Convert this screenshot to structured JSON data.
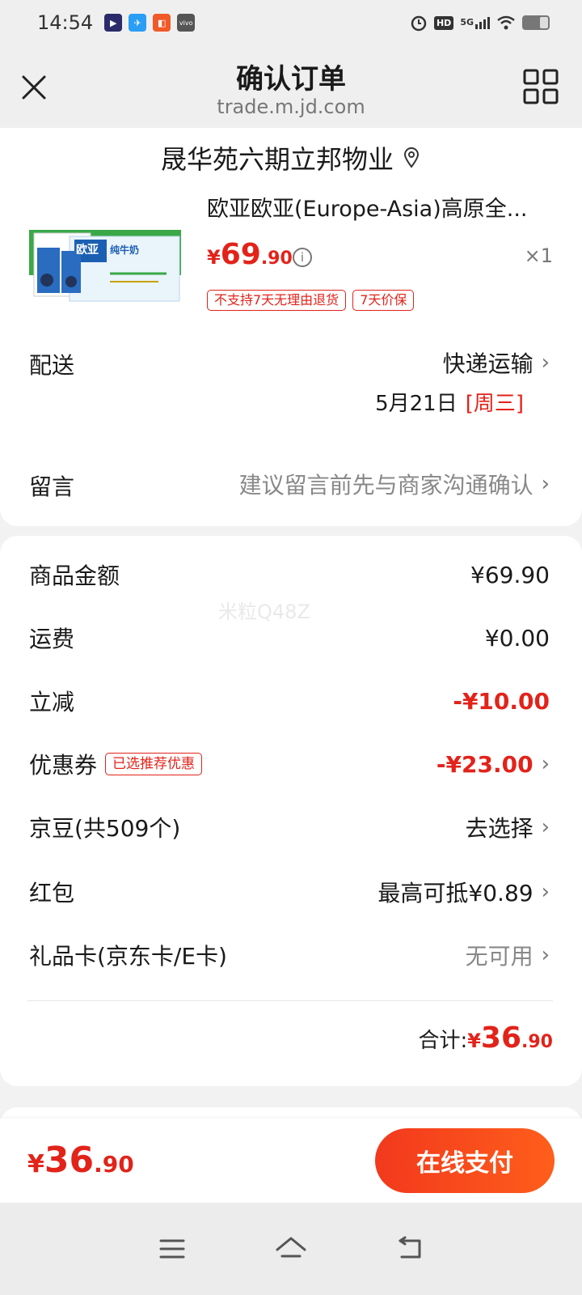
{
  "status_bar": {
    "time": "14:54",
    "apps": [
      {
        "icon": "media-app-icon",
        "color": "#2b2b6b",
        "glyph": "▶"
      },
      {
        "icon": "paper-plane-app-icon",
        "color": "#2a9df4",
        "glyph": "✈"
      },
      {
        "icon": "red-app-icon",
        "color": "#f05a28",
        "glyph": "◧"
      },
      {
        "icon": "vivo-app-icon",
        "color": "#555555",
        "glyph": "vivo"
      }
    ],
    "indicators": [
      "alarm-icon",
      "hd-icon",
      "5g-signal-icon",
      "wifi-icon",
      "battery-icon"
    ],
    "hd_label": "HD",
    "network_label": "5G"
  },
  "nav": {
    "title": "确认订单",
    "url": "trade.m.jd.com",
    "close_icon": "close-icon",
    "menu_icon": "grid-icon"
  },
  "address": {
    "text": "晟华苑六期立邦物业",
    "icon": "location-pin-icon"
  },
  "product": {
    "title": "欧亚欧亚(Europe-Asia)高原全...",
    "price_symbol": "¥",
    "price_int": "69",
    "price_dec": ".90",
    "quantity": "×1",
    "image_brand_text": "欧亚",
    "image_subtext": "纯牛奶",
    "tags": [
      "不支持7天无理由退货",
      "7天价保"
    ]
  },
  "delivery": {
    "label": "配送",
    "method": "快递运输",
    "date": "5月21日",
    "weekday": "[周三]"
  },
  "message": {
    "label": "留言",
    "hint": "建议留言前先与商家沟通确认"
  },
  "summary": {
    "watermark": "米粒Q48Z",
    "rows": [
      {
        "label": "商品金额",
        "value": "¥69.90"
      },
      {
        "label": "运费",
        "value": "¥0.00"
      },
      {
        "label": "立减",
        "value": "-¥10.00"
      },
      {
        "label": "优惠券",
        "tag": "已选推荐优惠",
        "value": "-¥23.00"
      },
      {
        "label": "京豆(共509个)",
        "value": "去选择"
      },
      {
        "label": "红包",
        "value": "最高可抵¥0.89"
      },
      {
        "label": "礼品卡(京东卡/E卡)",
        "value": "无可用"
      }
    ],
    "total_label": "合计:",
    "total_symbol": "¥",
    "total_int": "36",
    "total_dec": ".90"
  },
  "bottom": {
    "price_symbol": "¥",
    "price_int": "36",
    "price_dec": ".90",
    "pay_label": "在线支付"
  },
  "colors": {
    "accent_red": "#e2231a",
    "pay_gradient_start": "#f2391d",
    "pay_gradient_end": "#ff5e1b"
  },
  "system_nav": [
    "menu-lines-icon",
    "home-icon",
    "back-icon"
  ]
}
